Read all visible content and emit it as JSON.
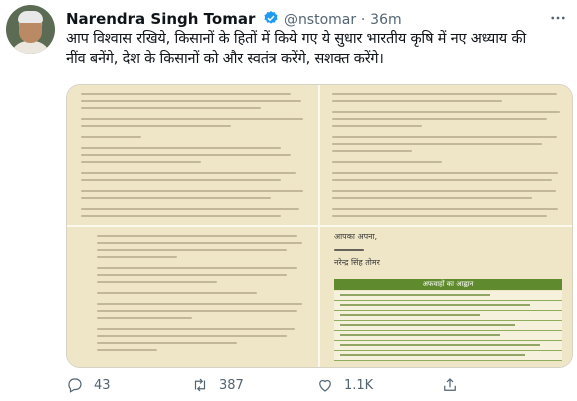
{
  "tweet": {
    "author_name": "Narendra Singh Tomar",
    "handle": "@nstomar",
    "separator": "·",
    "time": "36m",
    "text_line1": "आप विश्वास रखिये, किसानों के हितों में किये गए ये सुधार भारतीय कृषि में नए अध्याय की",
    "text_line2": "नींव बनेंगे, देश के किसानों को और स्वतंत्र करेंगे, सशक्त करेंगे।",
    "more_icon": "more-icon",
    "verified_color": "#1d9bf0"
  },
  "letter": {
    "signature": "नरेन्द्र सिंह तोमर",
    "closing": "आपका अपना,",
    "appeal_heading": "अफवाहों का आह्वान"
  },
  "actions": {
    "replies": "43",
    "retweets": "387",
    "likes": "1.1K"
  },
  "colors": {
    "muted": "#536471",
    "paper": "#efe6c8",
    "green": "#5f8a2e"
  }
}
